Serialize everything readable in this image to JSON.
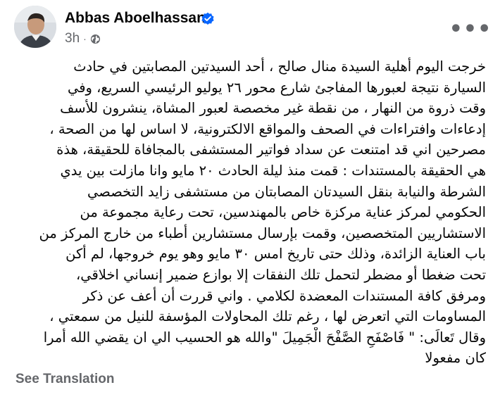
{
  "post": {
    "author_name": "Abbas Aboelhassan",
    "time": "3h",
    "separator": "·",
    "audience_icon": "globe-icon",
    "verified_icon": "verified-badge-icon",
    "more_icon_text": "•••",
    "lines": [
      "خرجت اليوم أهلية السيدة منال صالح ، أحد السيدتين المصابتين  في حادث",
      "السيارة  نتيجة لعبورها المفاجئ شارع محور ٢٦ يوليو  الرئيسي السريع، وفي",
      "وقت ذروة من النهار ، من نقطة غير مخصصة لعبور المشاة،  ينشرون للأسف",
      "إدعاءات وافتراءات في الصحف والمواقع الالكترونية، لا اساس لها من الصحة ،",
      "مصرحين اني قد امتنعت عن سداد فواتير المستشفى بالمجافاة للحقيقة،  هذة",
      "هي الحقيقة بالمستندات : قمت منذ ليلة الحادث ٢٠ مايو وانا مازلت بين يدي",
      "الشرطة والنيابة بنقل السيدتان المصابتان من مستشفى زايد التخصصي",
      "الحكومي لمركز عناية مركزة خاص بالمهندسين، تحت رعاية مجموعة من",
      "الاستشاريين المتخصصين، وقمت بإرسال مستشارين أطباء من خارج المركز من",
      "باب العناية الزائدة، وذلك حتى تاريخ امس ٣٠ مايو وهو يوم خروجها، لم أكن",
      "تحت ضغطا أو مضطر لتحمل تلك النفقات إلا بوازع  ضمير إنساني اخلاقي،",
      "ومرفق كافة المستندات المعضدة لكلامي .   واني قررت أن أعف عن ذكر",
      "المساومات التي اتعرض لها ، رغم تلك المحاولات المؤسفة للنيل من سمعتي ،",
      "وقال تَعالَى: \" فَاصْفَحِ الصَّفْحَ الْجَمِيلَ \"والله هو الحسيب الي ان يقضي الله أمرا",
      "كان مفعولا"
    ],
    "see_translation_label": "See Translation"
  },
  "colors": {
    "text_primary": "#050505",
    "text_secondary": "#65676b",
    "verified_blue": "#0866ff",
    "background": "#ffffff"
  }
}
